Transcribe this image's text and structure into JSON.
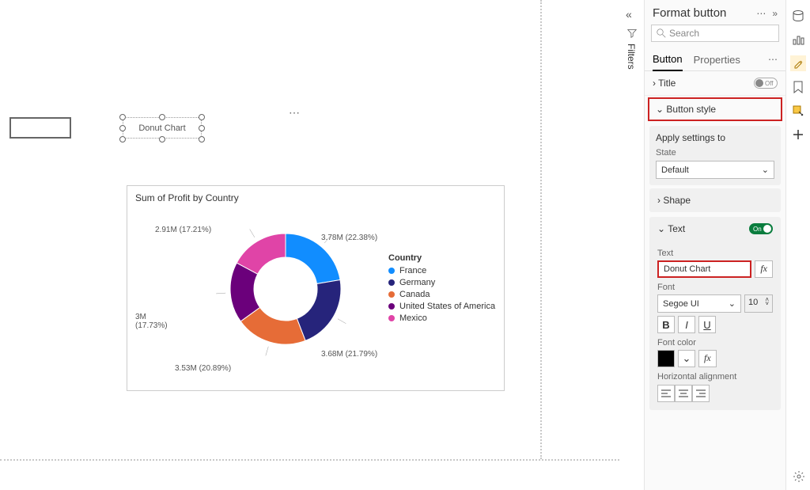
{
  "pane": {
    "title": "Format button",
    "search_placeholder": "Search",
    "tabs": {
      "button": "Button",
      "properties": "Properties"
    },
    "sections": {
      "title": {
        "label": "Title",
        "toggle": "Off"
      },
      "button_style": {
        "label": "Button style"
      },
      "apply_settings": {
        "label": "Apply settings to",
        "state_label": "State",
        "state_value": "Default"
      },
      "shape": {
        "label": "Shape"
      },
      "text": {
        "label": "Text",
        "toggle": "On",
        "field_label": "Text",
        "field_value": "Donut Chart",
        "font_label": "Font",
        "font_value": "Segoe UI",
        "font_size": "10",
        "font_color_label": "Font color",
        "horiz_align_label": "Horizontal alignment"
      }
    }
  },
  "filters_label": "Filters",
  "canvas": {
    "button_label": "Donut Chart",
    "chart_title": "Sum of Profit by Country",
    "legend_title": "Country"
  },
  "chart_data": {
    "type": "donut",
    "title": "Sum of Profit by Country",
    "series_name": "Country",
    "slices": [
      {
        "label": "France",
        "value": 3780000,
        "display": "3.78M",
        "pct": 22.38,
        "color": "#118dff"
      },
      {
        "label": "Germany",
        "value": 3680000,
        "display": "3.68M",
        "pct": 21.79,
        "color": "#26247b"
      },
      {
        "label": "Canada",
        "value": 3530000,
        "display": "3.53M",
        "pct": 20.89,
        "color": "#e66c37"
      },
      {
        "label": "United States of America",
        "value": 3000000,
        "display": "3M",
        "pct": 17.73,
        "color": "#6b007b"
      },
      {
        "label": "Mexico",
        "value": 2910000,
        "display": "2.91M",
        "pct": 17.21,
        "color": "#e044a7"
      }
    ]
  }
}
